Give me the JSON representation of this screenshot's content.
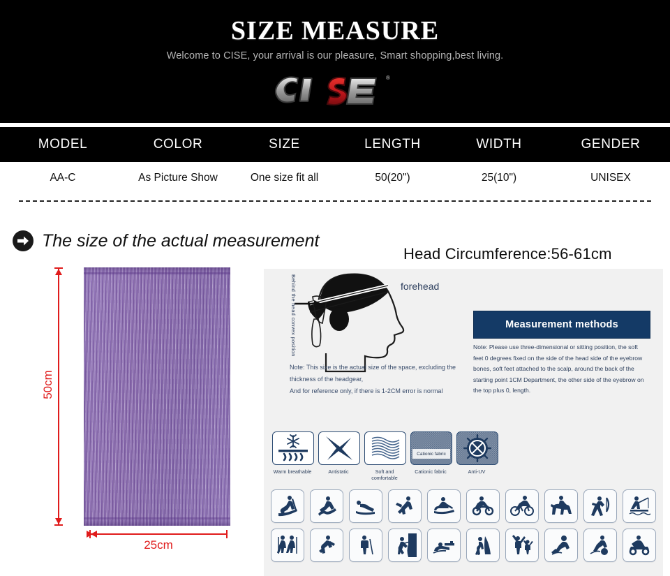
{
  "hero": {
    "title": "SIZE MEASURE",
    "subtitle": "Welcome to CISE, your arrival is our pleasure, Smart shopping,best living.",
    "logo_text": "CISE",
    "logo_mark": "cise-logo",
    "logo_colors": {
      "letters": "#b9b9b9",
      "accent": "#c3161c",
      "background": "#000000"
    },
    "registered_mark": "®"
  },
  "spec_table": {
    "headers": [
      "MODEL",
      "COLOR",
      "SIZE",
      "LENGTH",
      "WIDTH",
      "GENDER"
    ],
    "rows": [
      [
        "AA-C",
        "As Picture Show",
        "One size fit all",
        "50(20\")",
        "25(10\")",
        "UNISEX"
      ]
    ],
    "header_background": "#000000",
    "header_color": "#ffffff"
  },
  "section": {
    "bullet_icon": "arrow-right-circle-icon",
    "title": "The size of the actual measurement",
    "head_circumference": "Head Circumference:56-61cm"
  },
  "product": {
    "image_name": "purple-heather-tube-bandana",
    "color_hex": "#8a6ab0",
    "dimensions": {
      "height_label": "50cm",
      "width_label": "25cm",
      "arrow_color": "#e01b1b"
    }
  },
  "panel": {
    "head_diagram": {
      "name": "head-measurement-diagram",
      "forehead_label": "forehead",
      "back_label": "Behind the head convex position",
      "arrow_icon": "measure-point-arrow-icon"
    },
    "note_left": [
      "Note: This size is the actual size of the space, excluding the",
      "thickness of the headgear,",
      "And for reference only, if there is 1-2CM error is normal"
    ],
    "measurement_methods": {
      "heading": "Measurement methods",
      "heading_background": "#143a66",
      "body": [
        "Note: Please use three-dimensional or sitting position, the soft",
        "feet 0 degrees fixed on the side of the head side of the eyebrow",
        "bones, soft feet attached to the scalp, around the back of the",
        "starting point 1CM Department, the other side of the eyebrow on",
        "the top plus 0, length."
      ]
    },
    "features": [
      {
        "icon": "snowflake-breathable-icon",
        "label": "Warm breathable",
        "style": "plain"
      },
      {
        "icon": "antistatic-bolt-icon",
        "label": "Antistatic",
        "style": "plain"
      },
      {
        "icon": "soft-fabric-waves-icon",
        "label": "Soft and comfortable",
        "style": "plain"
      },
      {
        "icon": "cationic-fabric-icon",
        "label": "Cationic fabric",
        "style": "checker",
        "tag": "Cationic fabric"
      },
      {
        "icon": "anti-uv-sun-icon",
        "label": "Anti-UV",
        "style": "checker"
      }
    ],
    "sports_icons": [
      [
        "skiing-icon",
        "water-skiing-icon",
        "sledding-icon",
        "running-sprint-icon",
        "snowmobile-icon",
        "motorcycle-icon",
        "cycling-icon",
        "horse-riding-icon",
        "archery-icon",
        "fishing-icon"
      ],
      [
        "hiking-pair-icon",
        "jogging-icon",
        "trekking-pole-icon",
        "rock-climbing-icon",
        "shooting-prone-icon",
        "mountaineering-icon",
        "celebrating-pair-icon",
        "handball-icon",
        "soccer-icon",
        "atv-quad-icon"
      ]
    ],
    "background": "#f1f1f1",
    "accent": "#1e3a5f"
  }
}
